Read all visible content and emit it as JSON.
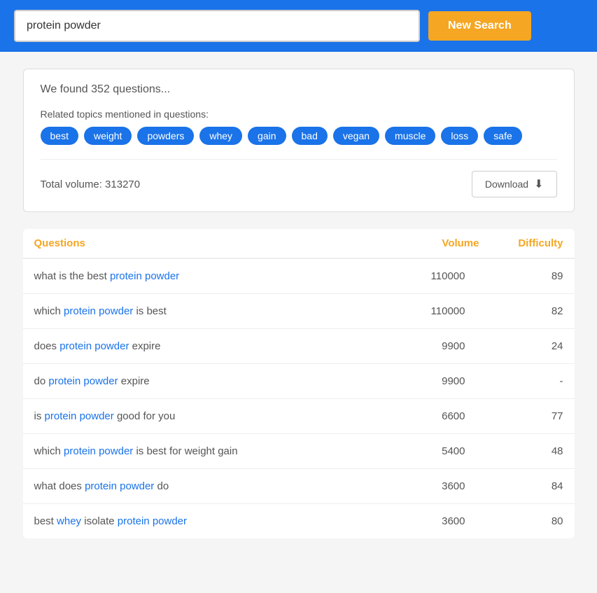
{
  "header": {
    "search_value": "protein powder",
    "search_placeholder": "protein powder",
    "new_search_label": "New Search"
  },
  "results": {
    "count_text": "We found 352 questions...",
    "related_label": "Related topics mentioned in questions:",
    "tags": [
      "best",
      "weight",
      "powders",
      "whey",
      "gain",
      "bad",
      "vegan",
      "muscle",
      "loss",
      "safe"
    ],
    "total_volume_label": "Total volume: 313270",
    "download_label": "Download"
  },
  "table": {
    "col_questions": "Questions",
    "col_volume": "Volume",
    "col_difficulty": "Difficulty",
    "rows": [
      {
        "question": "what is the best protein powder",
        "highlights": [
          "protein",
          "powder"
        ],
        "volume": "110000",
        "difficulty": "89"
      },
      {
        "question": "which protein powder is best",
        "highlights": [
          "protein",
          "powder"
        ],
        "volume": "110000",
        "difficulty": "82"
      },
      {
        "question": "does protein powder expire",
        "highlights": [
          "protein",
          "powder"
        ],
        "volume": "9900",
        "difficulty": "24"
      },
      {
        "question": "do protein powder expire",
        "highlights": [
          "protein",
          "powder"
        ],
        "volume": "9900",
        "difficulty": "-"
      },
      {
        "question": "is protein powder good for you",
        "highlights": [
          "protein",
          "powder"
        ],
        "volume": "6600",
        "difficulty": "77"
      },
      {
        "question": "which protein powder is best for weight gain",
        "highlights": [
          "protein",
          "powder"
        ],
        "volume": "5400",
        "difficulty": "48"
      },
      {
        "question": "what does protein powder do",
        "highlights": [
          "protein",
          "powder"
        ],
        "volume": "3600",
        "difficulty": "84"
      },
      {
        "question": "best whey isolate protein powder",
        "highlights": [
          "whey",
          "protein",
          "powder"
        ],
        "volume": "3600",
        "difficulty": "80"
      }
    ]
  }
}
